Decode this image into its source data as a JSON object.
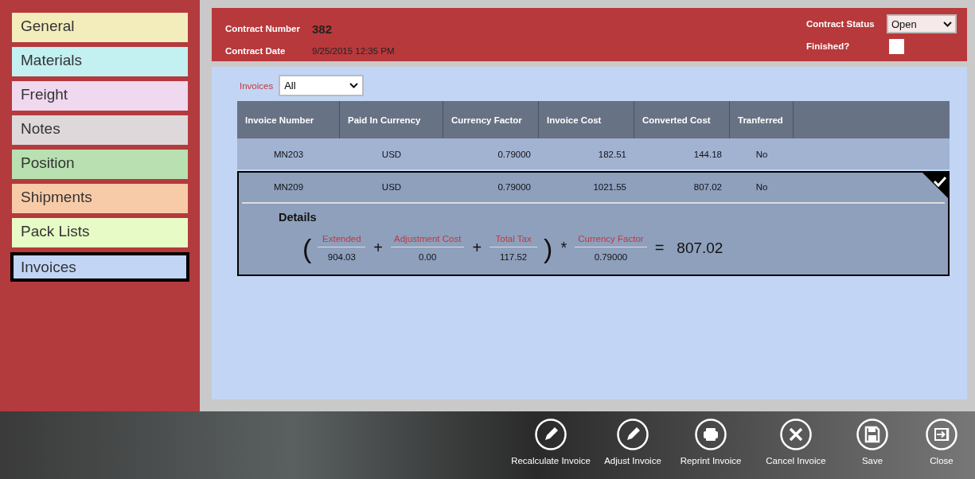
{
  "sidebar": {
    "items": [
      {
        "label": "General",
        "color": "#f2edbb",
        "selected": false
      },
      {
        "label": "Materials",
        "color": "#c3f0f0",
        "selected": false
      },
      {
        "label": "Freight",
        "color": "#f0d8ef",
        "selected": false
      },
      {
        "label": "Notes",
        "color": "#ded8db",
        "selected": false
      },
      {
        "label": "Position",
        "color": "#b8e0b0",
        "selected": false
      },
      {
        "label": "Shipments",
        "color": "#f8cba8",
        "selected": false
      },
      {
        "label": "Pack Lists",
        "color": "#e6fbc6",
        "selected": false
      },
      {
        "label": "Invoices",
        "color": "#c2d5f5",
        "selected": true
      }
    ]
  },
  "header": {
    "contract_number_label": "Contract Number",
    "contract_number": "382",
    "contract_date_label": "Contract Date",
    "contract_date": "9/25/2015 12:35 PM",
    "status_label": "Contract Status",
    "status": "Open",
    "finished_label": "Finished?",
    "finished": false
  },
  "filter": {
    "label": "Invoices",
    "value": "All"
  },
  "table": {
    "columns": [
      "Invoice Number",
      "Paid In Currency",
      "Currency Factor",
      "Invoice Cost",
      "Converted Cost",
      "Tranferred"
    ],
    "rows": [
      {
        "cells": [
          "MN203",
          "USD",
          "0.79000",
          "182.51",
          "144.18",
          "No"
        ],
        "selected": false,
        "expanded": false
      },
      {
        "cells": [
          "MN209",
          "USD",
          "0.79000",
          "1021.55",
          "807.02",
          "No"
        ],
        "selected": true,
        "expanded": true
      }
    ],
    "details": {
      "title": "Details",
      "formula": [
        {
          "kind": "paren",
          "text": "("
        },
        {
          "kind": "term",
          "label": "Extended",
          "value": "904.03"
        },
        {
          "kind": "op",
          "text": "+"
        },
        {
          "kind": "term",
          "label": "Adjustment Cost",
          "value": "0.00"
        },
        {
          "kind": "op",
          "text": "+"
        },
        {
          "kind": "term",
          "label": "Total Tax",
          "value": "117.52"
        },
        {
          "kind": "paren",
          "text": ")"
        },
        {
          "kind": "op",
          "text": "*"
        },
        {
          "kind": "term",
          "label": "Currency Factor",
          "value": "0.79000"
        },
        {
          "kind": "op",
          "text": "="
        },
        {
          "kind": "result",
          "text": "807.02"
        }
      ]
    }
  },
  "actions": [
    "Recalculate Invoice",
    "Adjust Invoice",
    "Reprint Invoice",
    "Cancel Invoice",
    "Save",
    "Close"
  ]
}
